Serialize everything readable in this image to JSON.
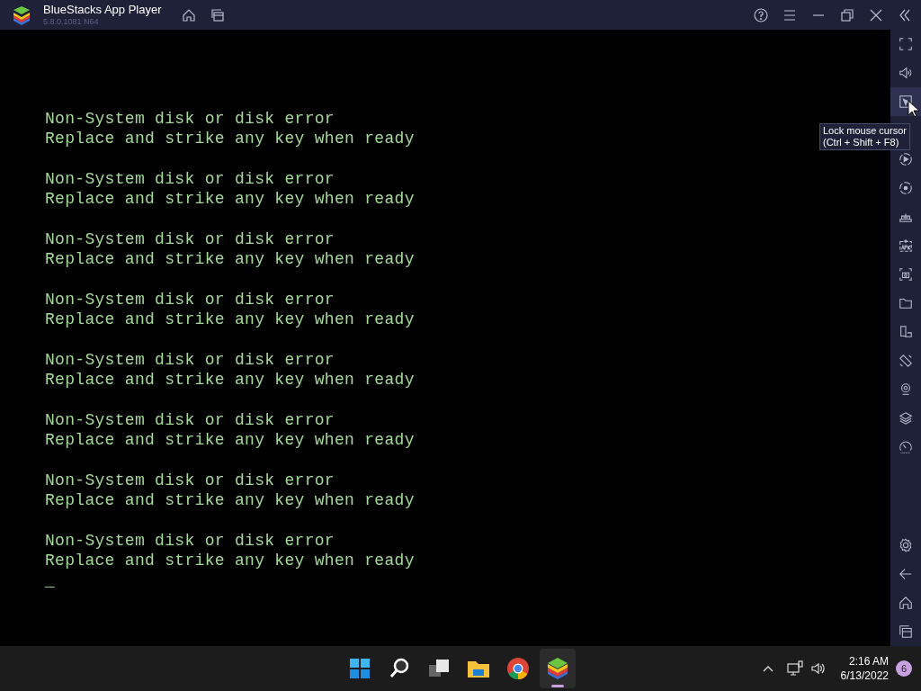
{
  "window": {
    "title": "BlueStacks App Player",
    "version": "5.8.0.1081 N64"
  },
  "console": {
    "lines": [
      "Non-System disk or disk error",
      "Replace and strike any key when ready",
      "Non-System disk or disk error",
      "Replace and strike any key when ready",
      "Non-System disk or disk error",
      "Replace and strike any key when ready",
      "Non-System disk or disk error",
      "Replace and strike any key when ready",
      "Non-System disk or disk error",
      "Replace and strike any key when ready",
      "Non-System disk or disk error",
      "Replace and strike any key when ready",
      "Non-System disk or disk error",
      "Replace and strike any key when ready",
      "Non-System disk or disk error",
      "Replace and strike any key when ready"
    ],
    "cursor": "_"
  },
  "sidebar": {
    "top": [
      {
        "kind": "fullscreen",
        "selected": false
      },
      {
        "kind": "volume",
        "selected": false
      },
      {
        "kind": "lock-cursor",
        "selected": true
      },
      {
        "kind": "play",
        "selected": false
      },
      {
        "kind": "record",
        "selected": false
      },
      {
        "kind": "controller",
        "selected": false
      },
      {
        "kind": "apk",
        "selected": false
      },
      {
        "kind": "screenshot",
        "selected": false
      },
      {
        "kind": "folder",
        "selected": false
      },
      {
        "kind": "devices",
        "selected": false
      },
      {
        "kind": "rotate",
        "selected": false
      },
      {
        "kind": "location",
        "selected": false
      },
      {
        "kind": "layers",
        "selected": false
      },
      {
        "kind": "speed",
        "selected": false
      }
    ],
    "bottom": [
      {
        "kind": "settings",
        "selected": false
      },
      {
        "kind": "back",
        "selected": false
      },
      {
        "kind": "home",
        "selected": false
      },
      {
        "kind": "recent",
        "selected": false
      }
    ]
  },
  "tooltip": {
    "lines": [
      "Lock mouse cursor",
      "(Ctrl + Shift + F8)"
    ]
  },
  "taskbar": {
    "apps": [
      {
        "kind": "start",
        "selected": false
      },
      {
        "kind": "search",
        "selected": false
      },
      {
        "kind": "taskview",
        "selected": false
      },
      {
        "kind": "explorer",
        "selected": false
      },
      {
        "kind": "browser",
        "selected": false
      },
      {
        "kind": "bluestacks",
        "selected": true
      }
    ],
    "time": "2:16 AM",
    "date": "6/13/2022",
    "notifications": "6"
  }
}
